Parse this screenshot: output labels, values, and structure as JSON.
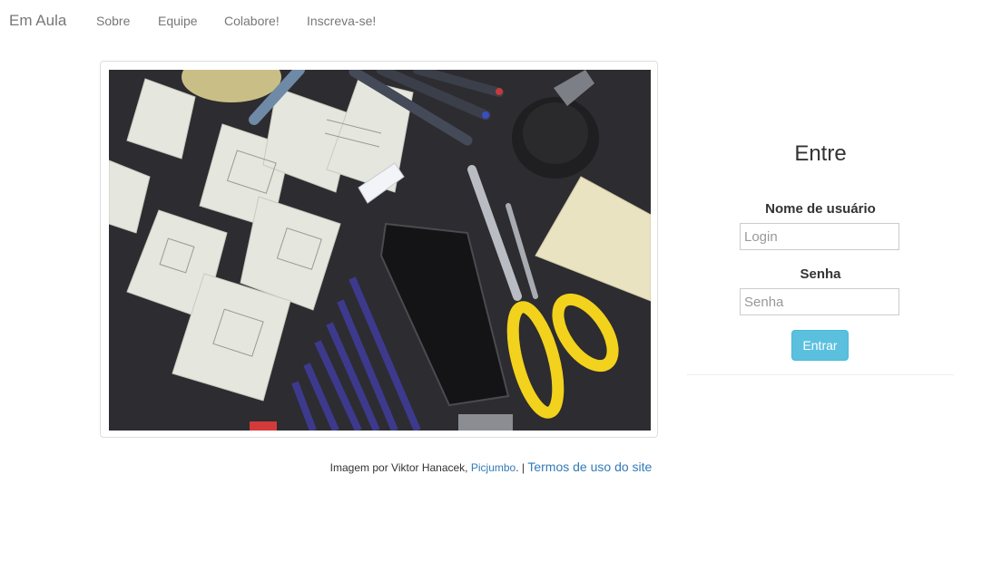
{
  "navbar": {
    "brand": "Em Aula",
    "links": [
      "Sobre",
      "Equipe",
      "Colabore!",
      "Inscreva-se!"
    ]
  },
  "hero": {
    "image_alt": "Mesa escura com esboços de wireframes, smartphone, tesoura amarela, lápis e post-its"
  },
  "login": {
    "title": "Entre",
    "username_label": "Nome de usuário",
    "username_placeholder": "Login",
    "password_label": "Senha",
    "password_placeholder": "Senha",
    "submit_label": "Entrar"
  },
  "footer": {
    "credit_prefix": "Imagem por Viktor Hanacek, ",
    "credit_link": "Picjumbo",
    "credit_suffix": ".",
    "separator": " | ",
    "terms_link": "Termos de uso do site"
  },
  "colors": {
    "nav_text": "#777777",
    "link": "#337ab7",
    "button": "#5bc0de"
  }
}
